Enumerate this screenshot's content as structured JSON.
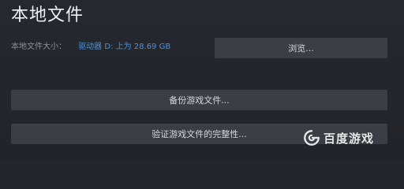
{
  "header": {
    "title": "本地文件"
  },
  "local_files": {
    "size_label": "本地文件大小：",
    "size_value": "驱动器 D: 上为 28.69 GB",
    "browse_label": "浏览...",
    "backup_label": "备份游戏文件...",
    "verify_label": "验证游戏文件的完整性..."
  },
  "watermark": {
    "text": "百度游戏",
    "icon": "baidu-game-logo-icon"
  },
  "colors": {
    "background": "#24262d",
    "button": "#3b3e45",
    "accent_blue": "#4d92d8",
    "label_gray": "#8b8f96"
  }
}
